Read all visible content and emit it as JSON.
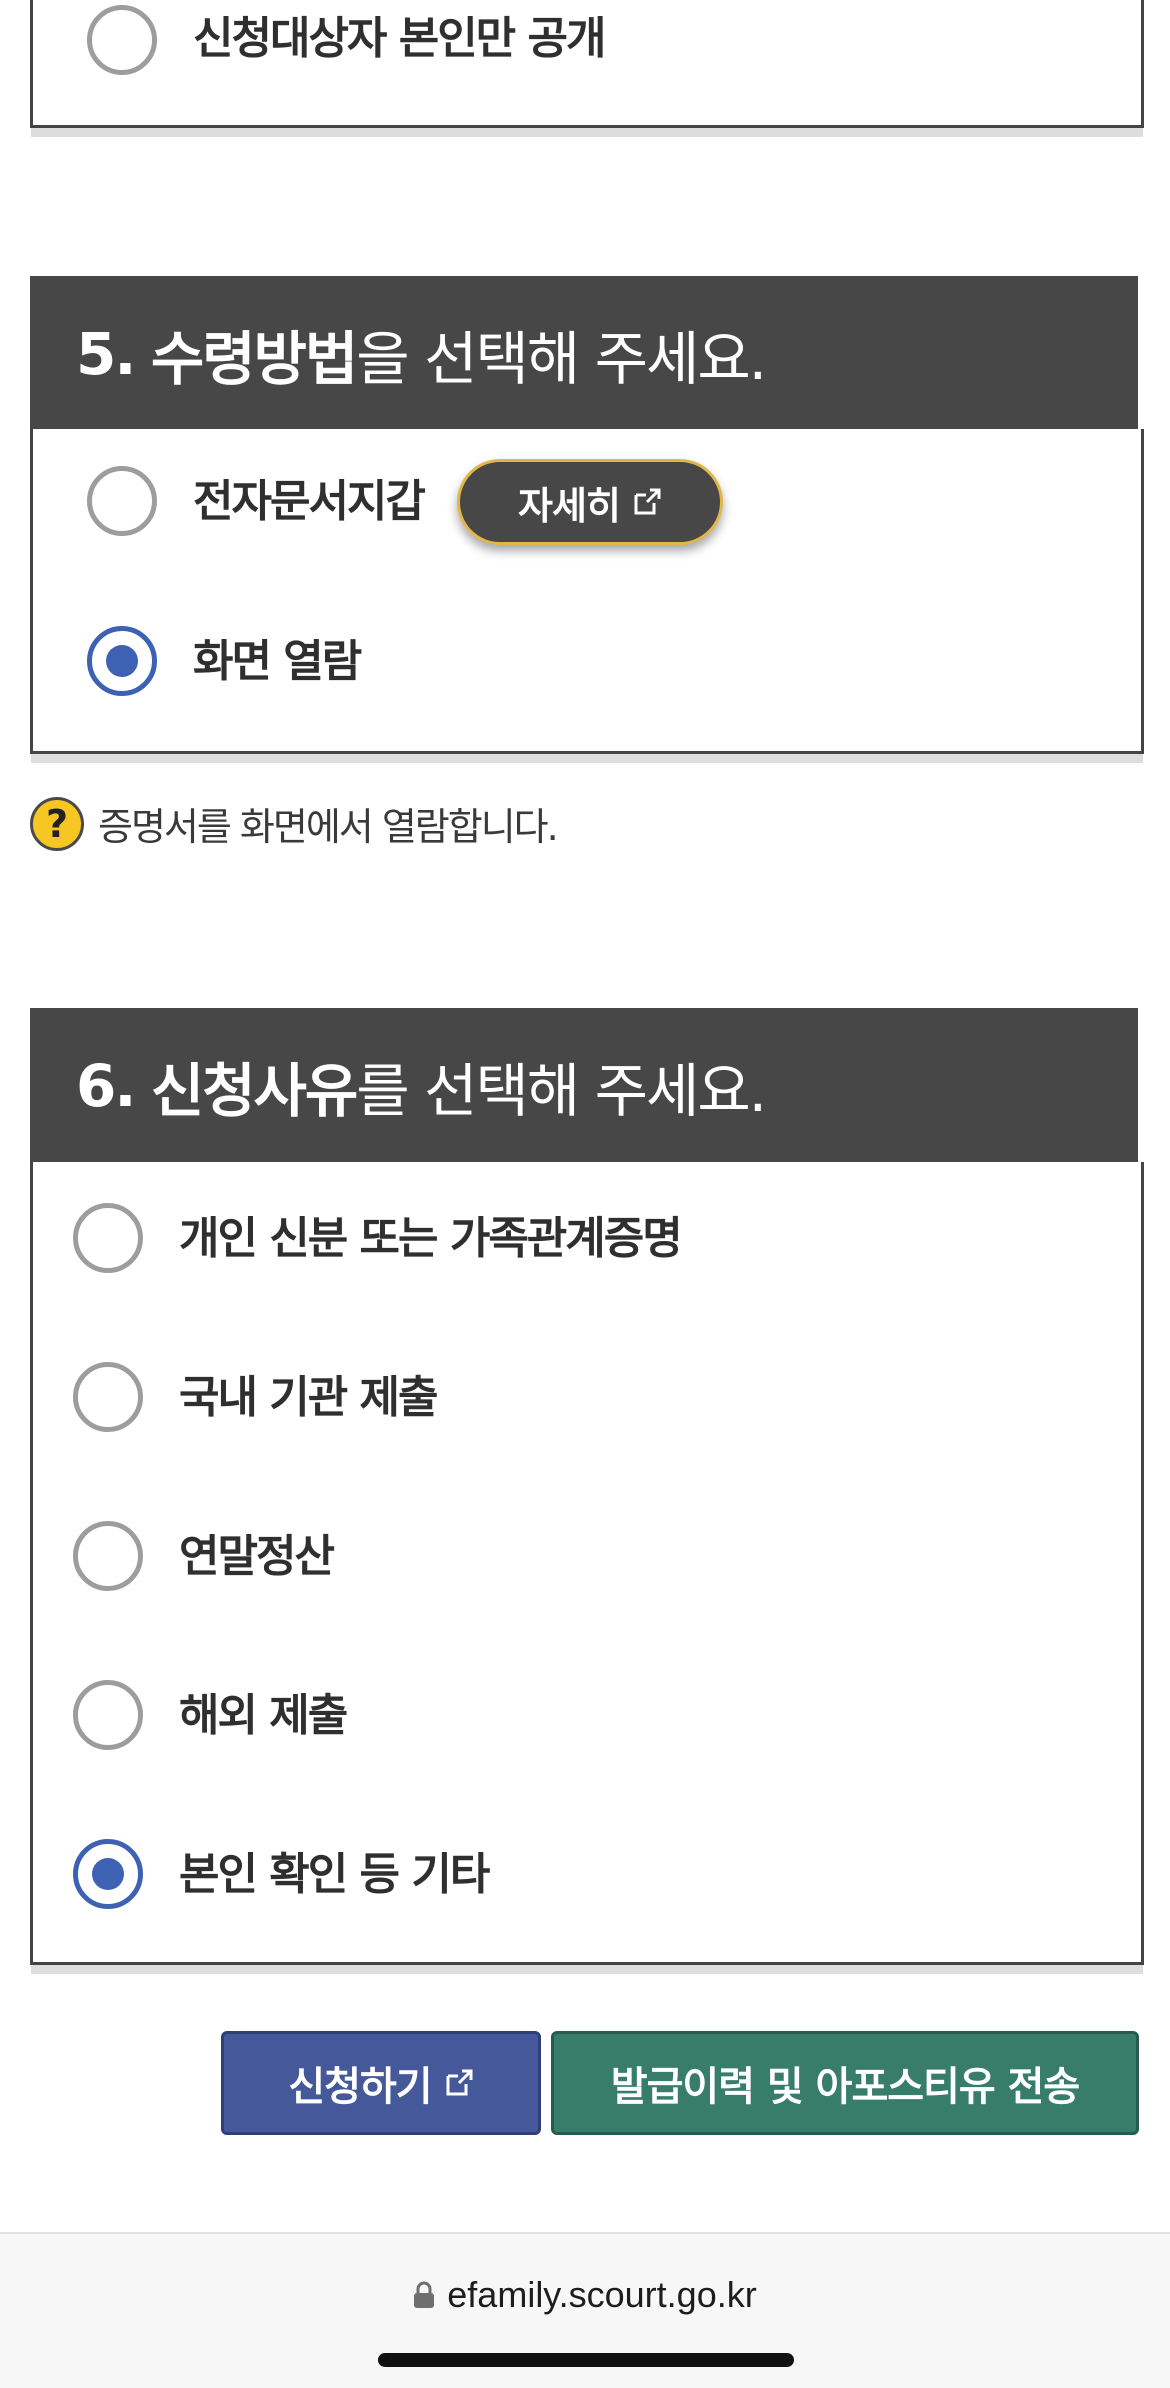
{
  "section4": {
    "option_private": "신청대상자 본인만 공개"
  },
  "section5": {
    "number": "5.",
    "bold": "수령방법",
    "rest": "을 선택해 주세요.",
    "options": [
      {
        "label": "전자문서지갑",
        "checked": false
      },
      {
        "label": "화면 열람",
        "checked": true
      }
    ],
    "detail_button": "자세히",
    "help_text": "증명서를 화면에서 열람합니다."
  },
  "section6": {
    "number": "6.",
    "bold": "신청사유",
    "rest": "를 선택해 주세요.",
    "options": [
      {
        "label": "개인 신분 또는 가족관계증명",
        "checked": false
      },
      {
        "label": "국내 기관 제출",
        "checked": false
      },
      {
        "label": "연말정산",
        "checked": false
      },
      {
        "label": "해외 제출",
        "checked": false
      },
      {
        "label": "본인 확인 등 기타",
        "checked": true
      }
    ]
  },
  "actions": {
    "apply_label": "신청하기",
    "send_label": "발급이력 및 아포스티유 전송"
  },
  "browser": {
    "url": "efamily.scourt.go.kr"
  },
  "icons": {
    "external_link": "external-link-icon",
    "help": "question-icon",
    "lock": "lock-icon"
  },
  "colors": {
    "header_bg": "#474747",
    "radio_checked": "#3d61b3",
    "apply_button": "#44589a",
    "send_button": "#377d6a",
    "help_icon": "#f6c623"
  }
}
